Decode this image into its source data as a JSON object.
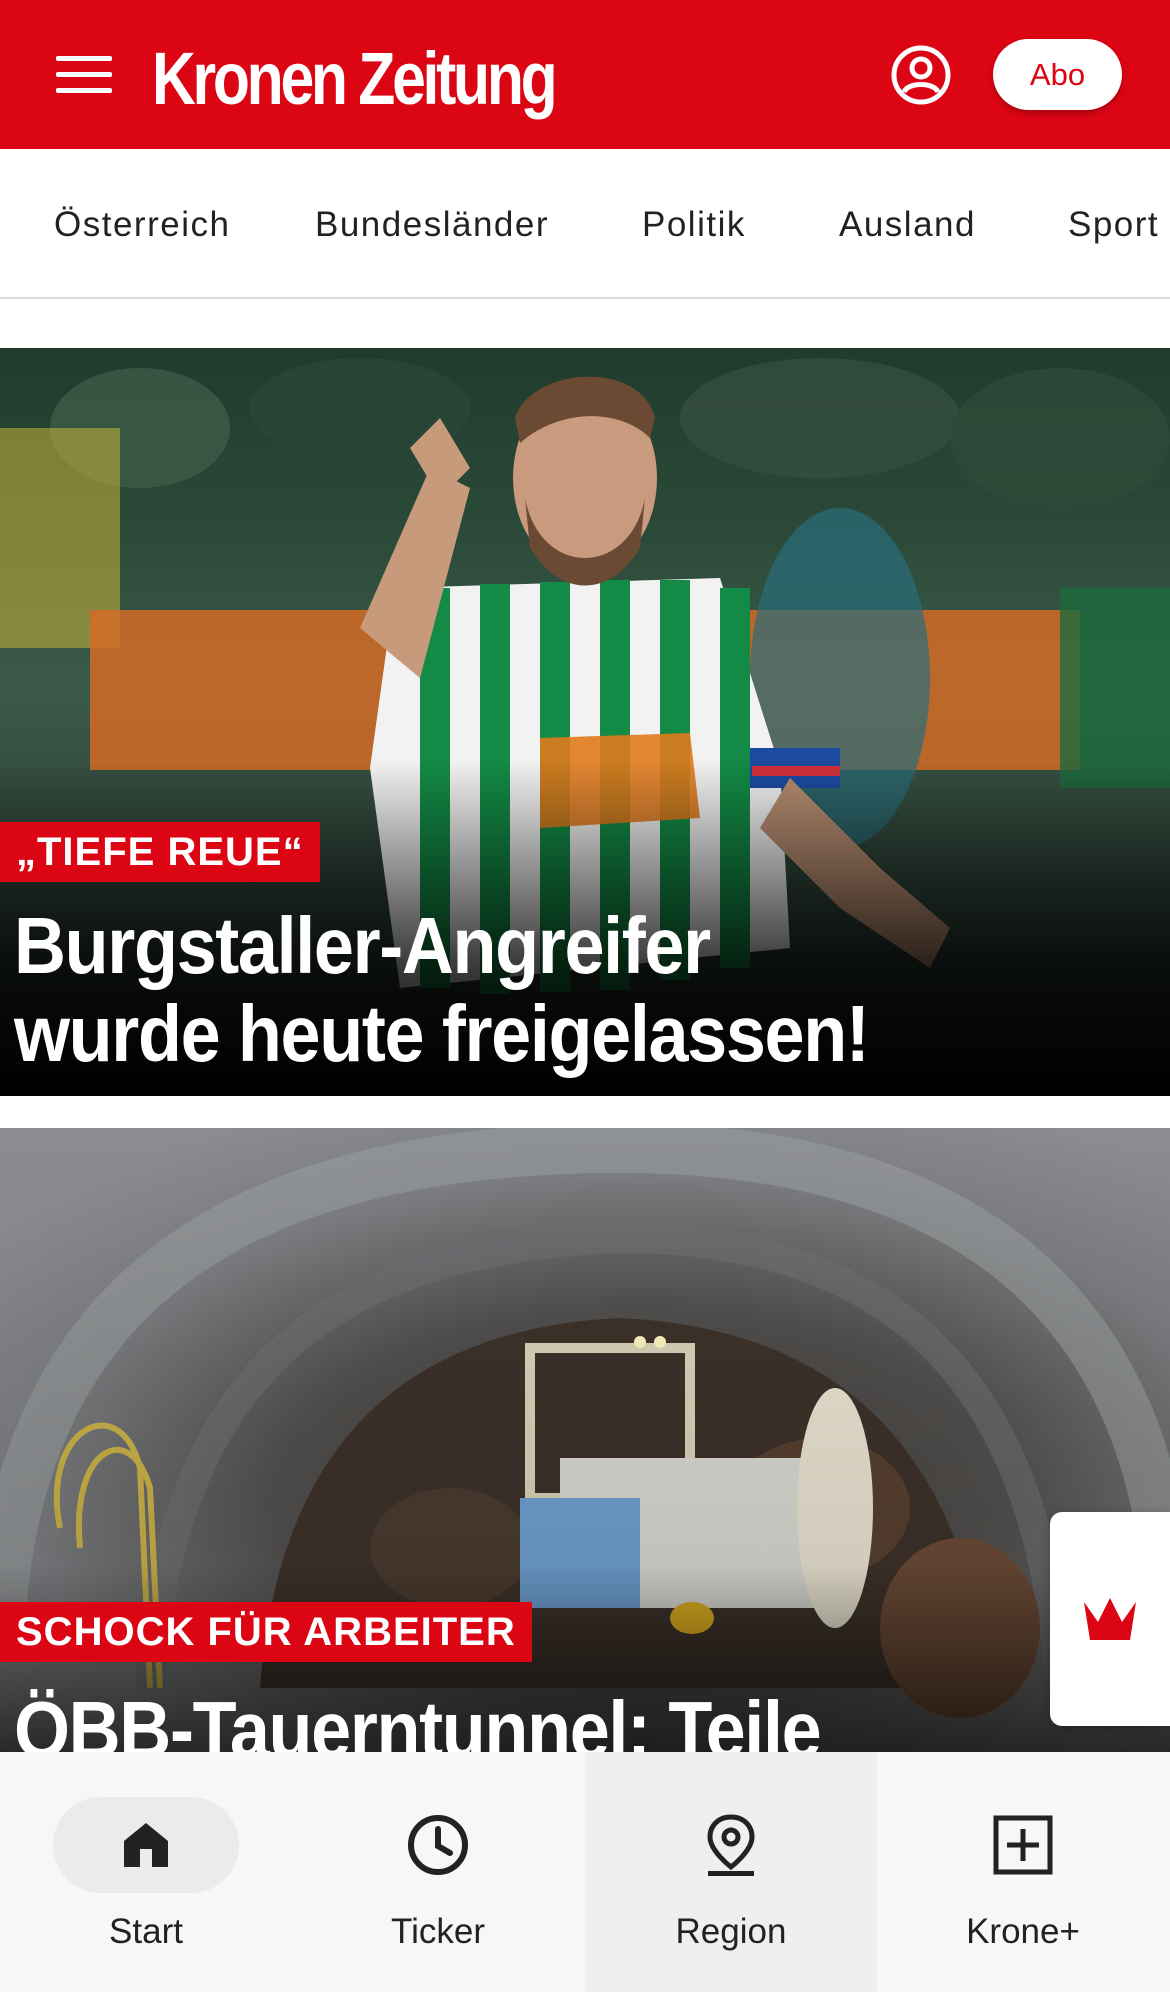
{
  "header": {
    "logo_text": "Kronen Zeitung",
    "abo_label": "Abo",
    "brand_color": "#dc0514"
  },
  "nav": {
    "items": [
      "Österreich",
      "Bundesländer",
      "Politik",
      "Ausland",
      "Sport"
    ]
  },
  "articles": [
    {
      "kicker": "„TIEFE REUE“",
      "headline_line1": "Burgstaller-Angreifer",
      "headline_line2": "wurde heute freigelassen!"
    },
    {
      "kicker": "SCHOCK FÜR ARBEITER",
      "headline_line1": "ÖBB-Tauerntunnel: Teile"
    }
  ],
  "bottom_nav": {
    "items": [
      {
        "label": "Start",
        "icon": "home-icon",
        "active": true
      },
      {
        "label": "Ticker",
        "icon": "clock-icon"
      },
      {
        "label": "Region",
        "icon": "location-pin-icon"
      },
      {
        "label": "Krone+",
        "icon": "plus-box-icon"
      }
    ]
  }
}
